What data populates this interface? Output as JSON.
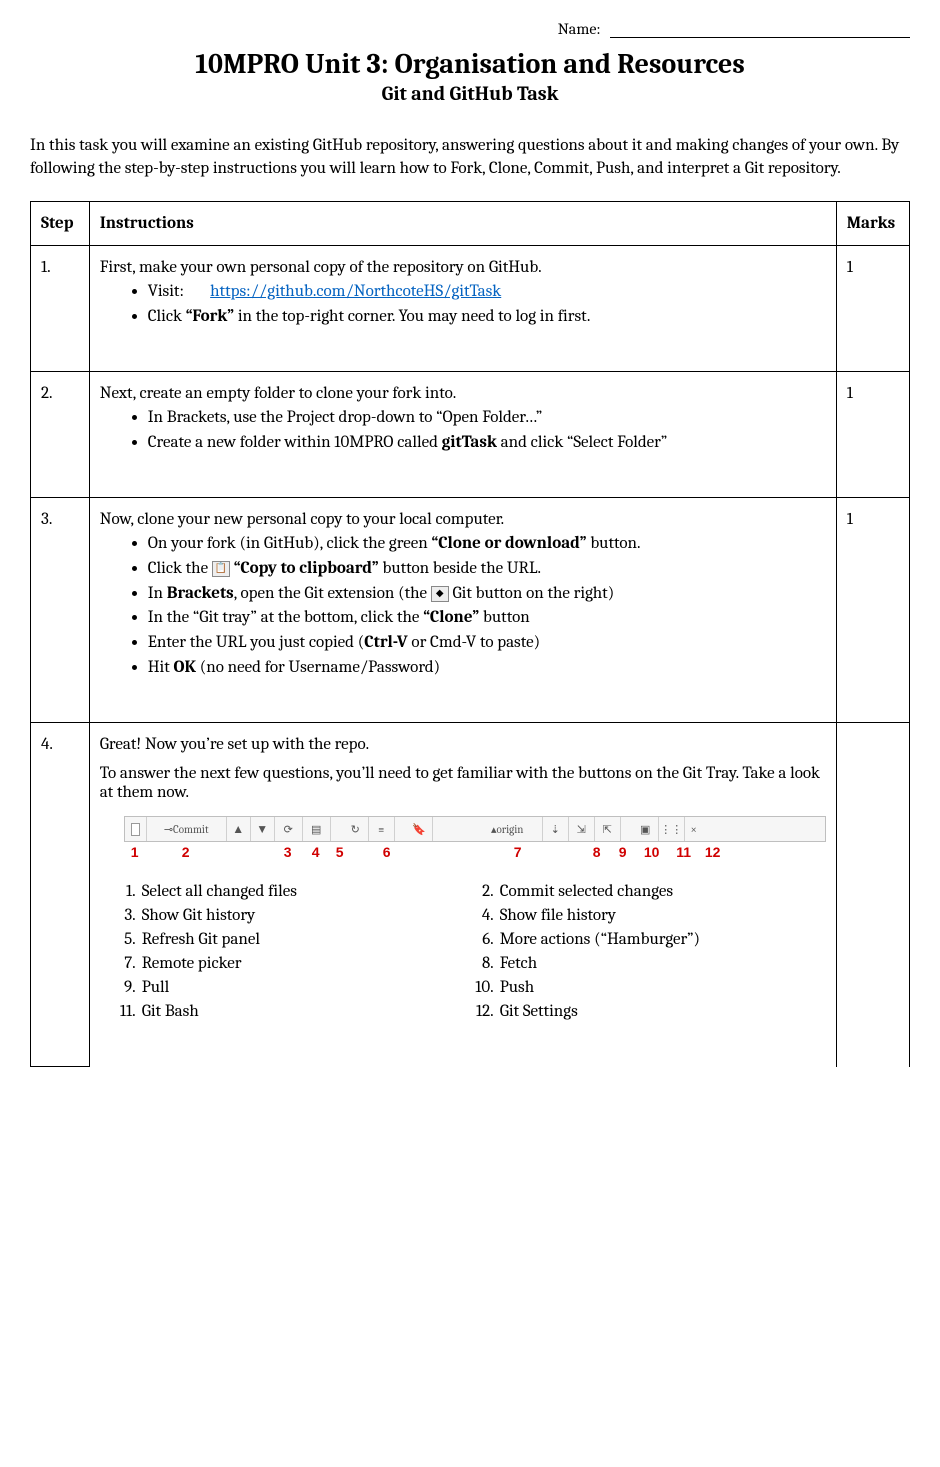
{
  "header": {
    "name_label": "Name:",
    "title": "10MPRO Unit 3: Organisation and Resources",
    "subtitle": "Git and GitHub Task"
  },
  "intro": "In this task you will examine an existing GitHub repository, answering questions about it and making changes of your own. By following the step-by-step instructions you will learn how to Fork, Clone, Commit, Push, and interpret a Git repository.",
  "table": {
    "col_step": "Step",
    "col_instr": "Instructions",
    "col_marks": "Marks"
  },
  "rows": {
    "r1": {
      "step": "1.",
      "lead": "First, make your own personal copy of the repository on GitHub.",
      "b1a": "Visit:",
      "b1_link": "https://github.com/NorthcoteHS/gitTask",
      "b2a": "Click ",
      "b2b": "“Fork”",
      "b2c": " in the top-right corner. You may need to log in first.",
      "marks": "1"
    },
    "r2": {
      "step": "2.",
      "lead": "Next, create an empty folder to clone your fork into.",
      "b1": "In Brackets, use the Project drop-down to “Open Folder…”",
      "b2a": "Create a new folder within 10MPRO called ",
      "b2b": "gitTask",
      "b2c": " and click “Select Folder”",
      "marks": "1"
    },
    "r3": {
      "step": "3.",
      "lead": "Now, clone your new personal copy to your local computer.",
      "b1a": "On your fork (in GitHub), click the green ",
      "b1b": "“Clone or download”",
      "b1c": " button.",
      "b2a": "Click the ",
      "b2b": " “Copy to clipboard”",
      "b2c": " button beside the URL.",
      "b3a": "In ",
      "b3b": "Brackets",
      "b3c": ", open the Git extension (the ",
      "b3d": " Git button on the right)",
      "b4a": "In the “Git tray” at the bottom, click the ",
      "b4b": "“Clone”",
      "b4c": " button",
      "b5a": "Enter the URL you just copied (",
      "b5b": "Ctrl-V",
      "b5c": " or Cmd-V to paste)",
      "b6a": "Hit ",
      "b6b": "OK",
      "b6c": " (no need for Username/Password)",
      "marks": "1"
    },
    "r4": {
      "step": "4.",
      "p1": "Great! Now you’re set up with the repo.",
      "p2": "To answer the next few questions, you’ll need to get familiar with the buttons on the Git Tray. Take a look at them now.",
      "tray": {
        "commit": "Commit",
        "origin": "origin"
      },
      "nums": [
        "1",
        "2",
        "3",
        "4",
        "5",
        "6",
        "7",
        "8",
        "9",
        "10",
        "11",
        "12"
      ],
      "legend": {
        "l1": "Select all changed files",
        "l2": "Commit selected changes",
        "l3": "Show Git history",
        "l4": "Show file history",
        "l5": "Refresh Git panel",
        "l6": "More actions (“Hamburger”)",
        "l7": "Remote picker",
        "l8": "Fetch",
        "l9": "Pull",
        "l10": "Push",
        "l11": "Git Bash",
        "l12": "Git Settings"
      },
      "marks": ""
    }
  }
}
